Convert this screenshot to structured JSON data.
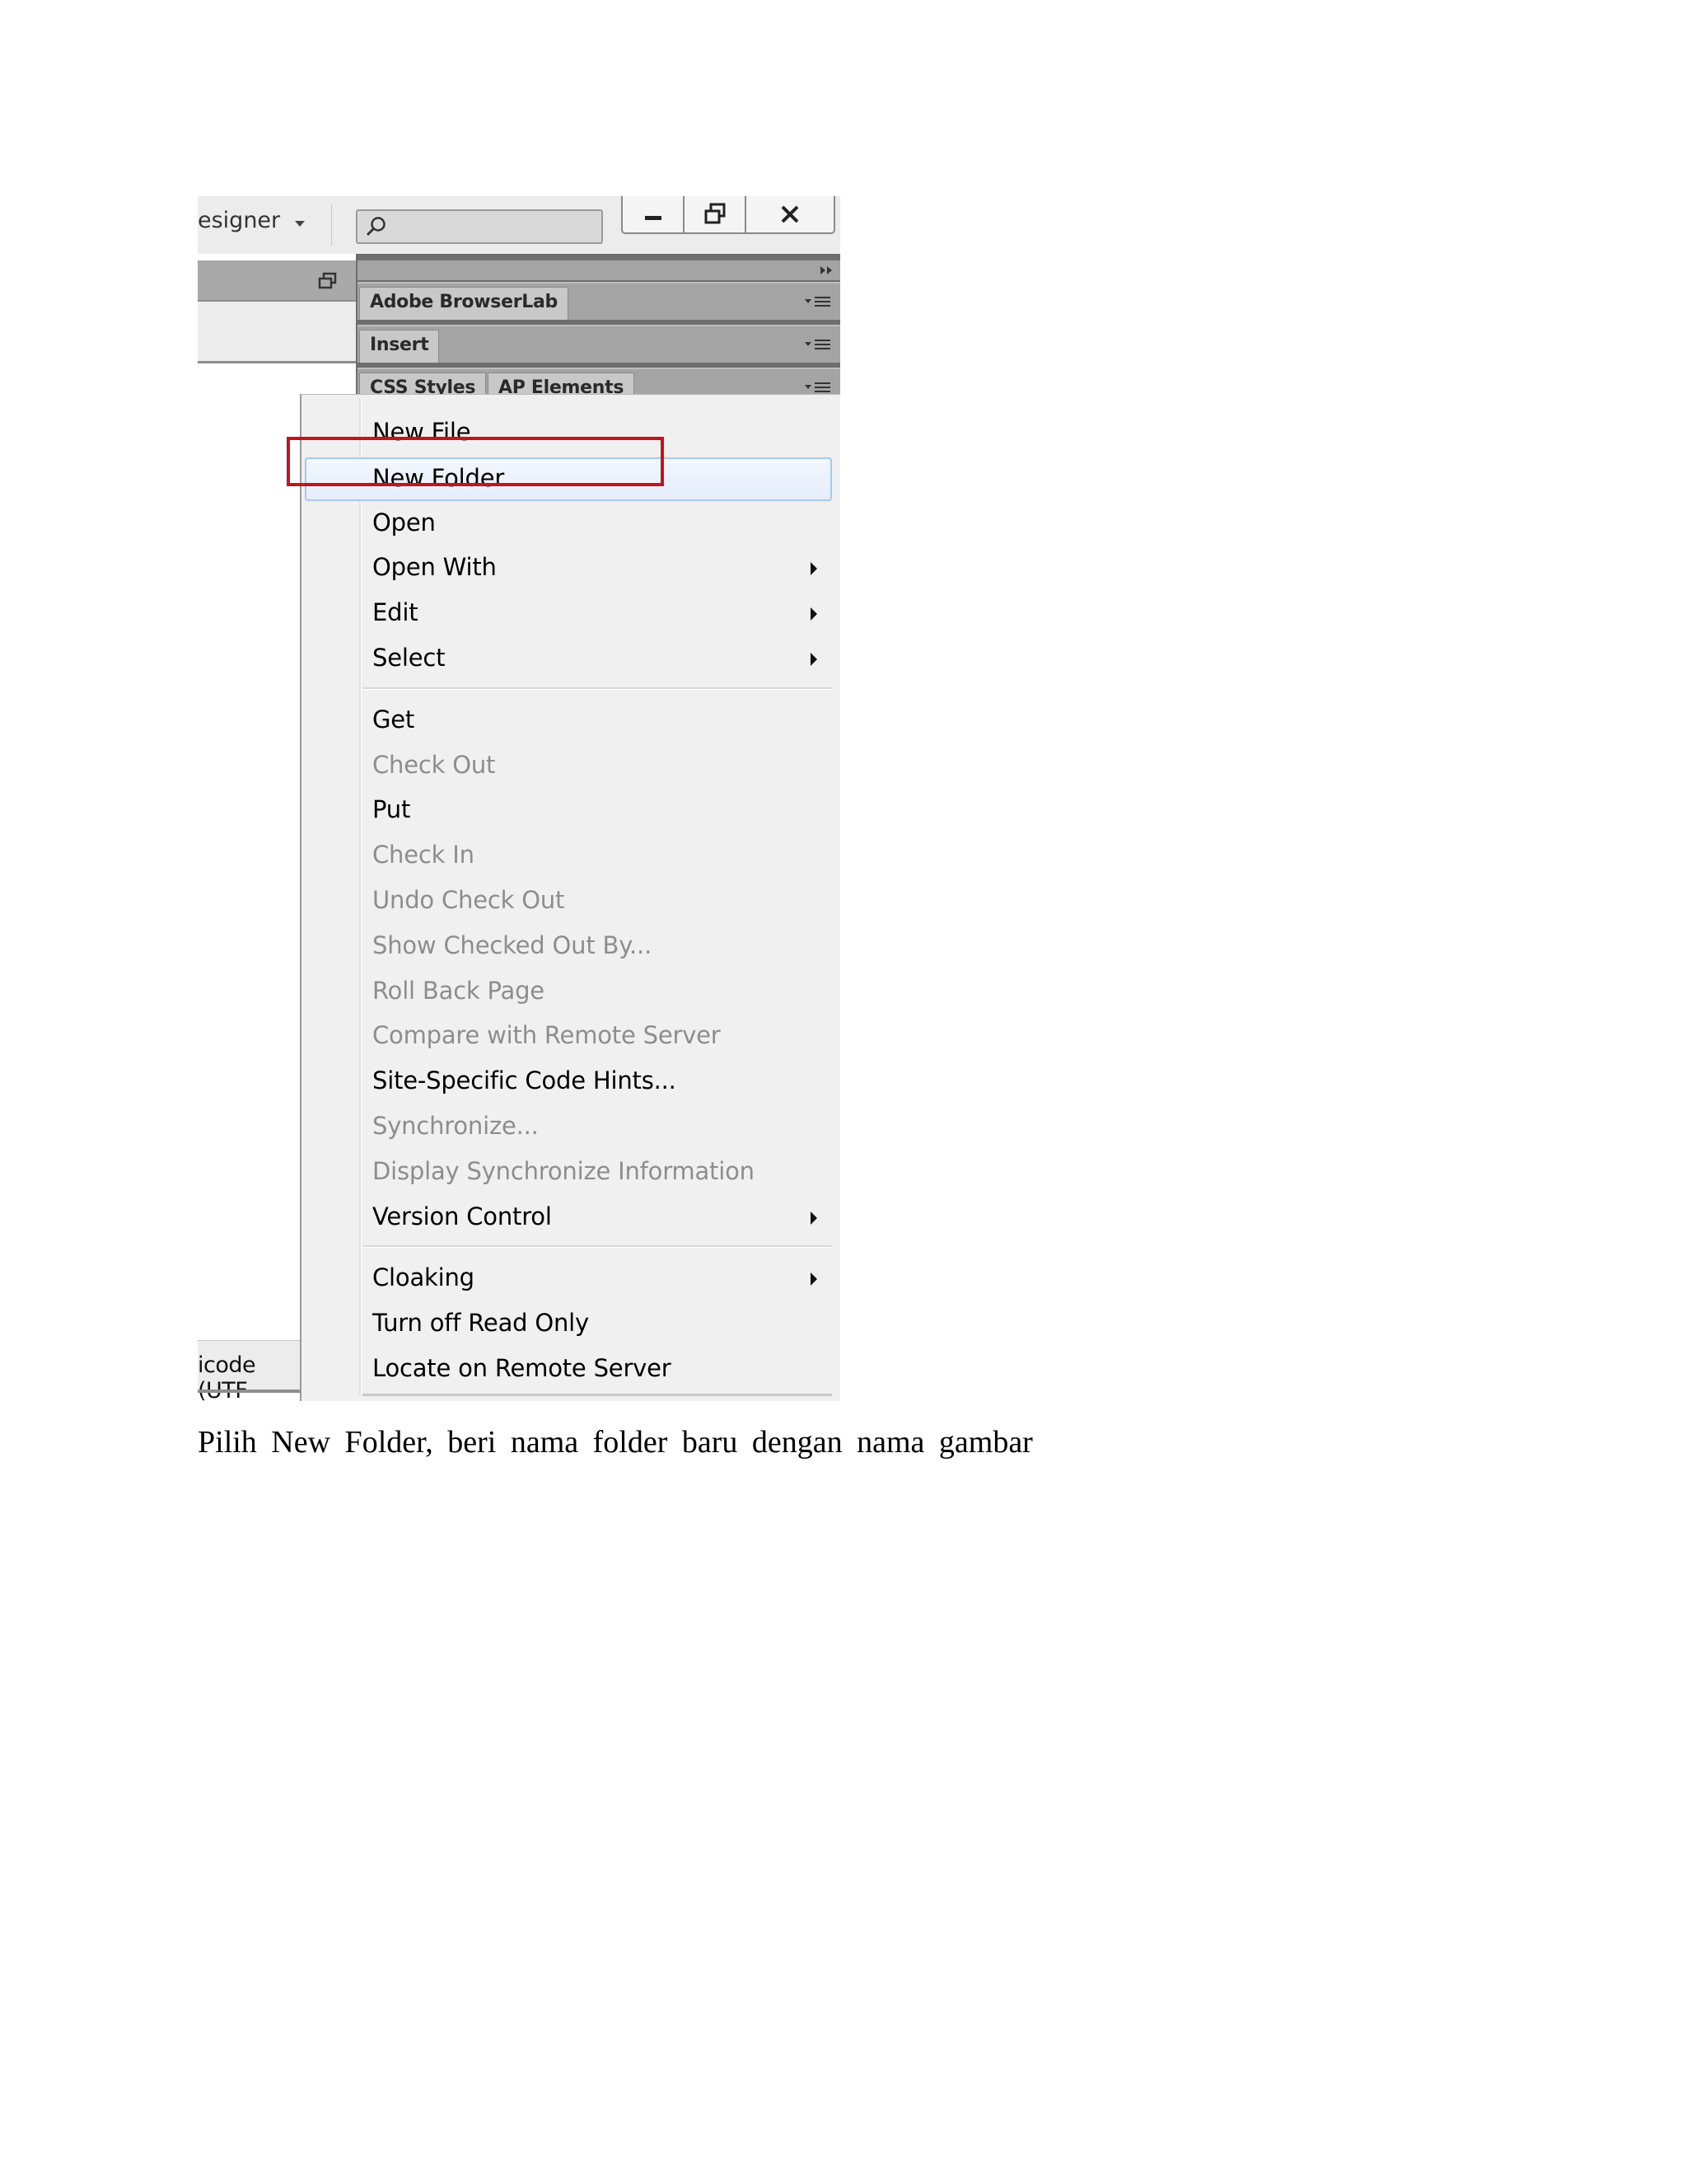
{
  "screenshot": {
    "workspace_label": "esigner",
    "status_text": "icode (UTF",
    "panels": [
      {
        "tabs": [
          "Adobe BrowserLab"
        ]
      },
      {
        "tabs": [
          "Insert"
        ]
      },
      {
        "tabs": [
          "CSS Styles",
          "AP Elements"
        ]
      }
    ],
    "menu_groups": [
      [
        {
          "label": "New File",
          "enabled": true,
          "submenu": false
        },
        {
          "label": "New Folder",
          "enabled": true,
          "submenu": false,
          "highlighted": true
        },
        {
          "label": "Open",
          "enabled": true,
          "submenu": false
        },
        {
          "label": "Open With",
          "enabled": true,
          "submenu": true
        },
        {
          "label": "Edit",
          "enabled": true,
          "submenu": true
        },
        {
          "label": "Select",
          "enabled": true,
          "submenu": true
        }
      ],
      [
        {
          "label": "Get",
          "enabled": true,
          "submenu": false
        },
        {
          "label": "Check Out",
          "enabled": false,
          "submenu": false
        },
        {
          "label": "Put",
          "enabled": true,
          "submenu": false
        },
        {
          "label": "Check In",
          "enabled": false,
          "submenu": false
        },
        {
          "label": "Undo Check Out",
          "enabled": false,
          "submenu": false
        },
        {
          "label": "Show Checked Out By...",
          "enabled": false,
          "submenu": false
        },
        {
          "label": "Roll Back Page",
          "enabled": false,
          "submenu": false
        },
        {
          "label": "Compare with Remote Server",
          "enabled": false,
          "submenu": false
        },
        {
          "label": "Site-Specific Code Hints...",
          "enabled": true,
          "submenu": false
        },
        {
          "label": "Synchronize...",
          "enabled": false,
          "submenu": false
        },
        {
          "label": "Display Synchronize Information",
          "enabled": false,
          "submenu": false
        },
        {
          "label": "Version Control",
          "enabled": true,
          "submenu": true
        }
      ],
      [
        {
          "label": "Cloaking",
          "enabled": true,
          "submenu": true
        },
        {
          "label": "Turn off Read Only",
          "enabled": true,
          "submenu": false
        },
        {
          "label": "Locate on Remote Server",
          "enabled": true,
          "submenu": false
        }
      ]
    ],
    "highlight_color": "#c0151b",
    "hover_color": "#a9c7ec",
    "disabled_text_color": "#8d8d8d"
  },
  "caption": "Pilih New Folder, beri nama folder baru dengan nama gambar"
}
